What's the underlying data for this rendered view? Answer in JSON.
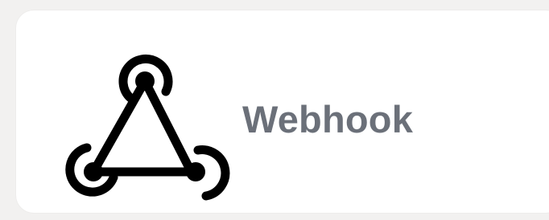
{
  "integration": {
    "name": "Webhook",
    "icon": "webhook-icon"
  },
  "colors": {
    "page_background": "#f2f1f0",
    "card_background": "#ffffff",
    "label": "#6b7079",
    "icon": "#000000"
  }
}
